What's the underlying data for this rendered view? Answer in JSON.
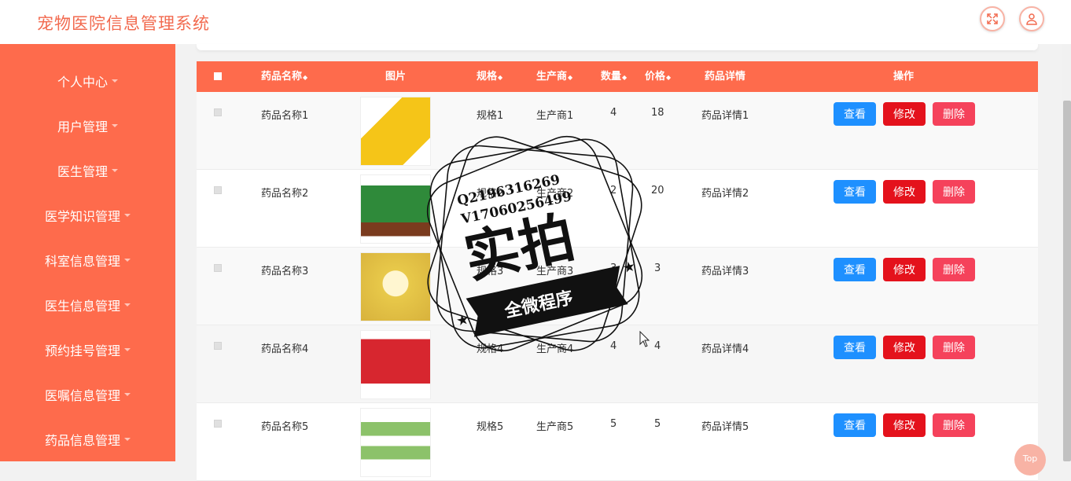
{
  "header": {
    "title": "宠物医院信息管理系统"
  },
  "sidebar": {
    "items": [
      {
        "label": "个人中心"
      },
      {
        "label": "用户管理"
      },
      {
        "label": "医生管理"
      },
      {
        "label": "医学知识管理"
      },
      {
        "label": "科室信息管理"
      },
      {
        "label": "医生信息管理"
      },
      {
        "label": "预约挂号管理"
      },
      {
        "label": "医嘱信息管理"
      },
      {
        "label": "药品信息管理"
      }
    ]
  },
  "table": {
    "headers": {
      "name": "药品名称",
      "image": "图片",
      "spec": "规格",
      "maker": "生产商",
      "qty": "数量",
      "price": "价格",
      "detail": "药品详情",
      "actions": "操作"
    },
    "rows": [
      {
        "name": "药品名称1",
        "spec": "规格1",
        "maker": "生产商1",
        "qty": "4",
        "price": "18",
        "detail": "药品详情1",
        "img_color": "#f5c518"
      },
      {
        "name": "药品名称2",
        "spec": "规格2",
        "maker": "生产商2",
        "qty": "2",
        "price": "20",
        "detail": "药品详情2",
        "img_color": "#2f8a3a"
      },
      {
        "name": "药品名称3",
        "spec": "规格3",
        "maker": "生产商3",
        "qty": "3",
        "price": "3",
        "detail": "药品详情3",
        "img_color": "#e8c94a"
      },
      {
        "name": "药品名称4",
        "spec": "规格4",
        "maker": "生产商4",
        "qty": "4",
        "price": "4",
        "detail": "药品详情4",
        "img_color": "#d7262f"
      },
      {
        "name": "药品名称5",
        "spec": "规格5",
        "maker": "生产商5",
        "qty": "5",
        "price": "5",
        "detail": "药品详情5",
        "img_color": "#8cc26a"
      }
    ],
    "buttons": {
      "view": "查看",
      "edit": "修改",
      "delete": "删除"
    }
  },
  "watermark": {
    "line1": "Q2196316269",
    "line2": "V17060256499",
    "main": "实拍",
    "banner": "全微程序"
  },
  "back_to_top": "Top",
  "colors": {
    "primary": "#fe6b4c",
    "title": "#f26a4f",
    "view": "#1e90ff",
    "edit": "#e4121c",
    "delete": "#f5425b"
  }
}
